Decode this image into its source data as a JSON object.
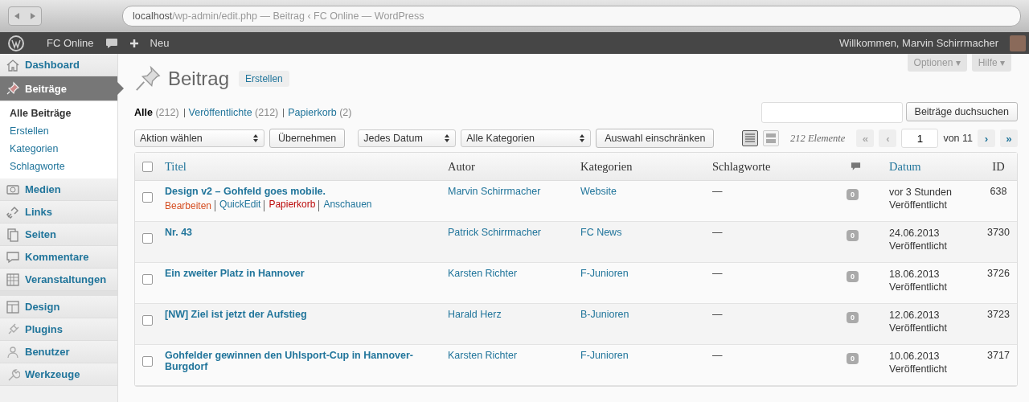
{
  "browser": {
    "address_host": "localhost",
    "address_path": "/wp-admin/edit.php — Beitrag ‹ FC Online — WordPress"
  },
  "admin_bar": {
    "site": "FC Online",
    "new": "Neu",
    "greeting": "Willkommen, Marvin Schirrmacher"
  },
  "screen_meta": [
    "Optionen ▾",
    "Hilfe ▾"
  ],
  "sidebar": {
    "items": [
      {
        "label": "Dashboard",
        "kind": "dashboard",
        "selected": false
      },
      {
        "label": "Beiträge",
        "kind": "posts",
        "selected": true,
        "children": [
          {
            "label": "Alle Beiträge",
            "selected": true
          },
          {
            "label": "Erstellen",
            "selected": false
          },
          {
            "label": "Kategorien",
            "selected": false
          },
          {
            "label": "Schlagworte",
            "selected": false
          }
        ]
      },
      {
        "label": "Medien",
        "kind": "media",
        "selected": false
      },
      {
        "label": "Links",
        "kind": "links",
        "selected": false
      },
      {
        "label": "Seiten",
        "kind": "pages",
        "selected": false
      },
      {
        "label": "Kommentare",
        "kind": "comments",
        "selected": false
      },
      {
        "label": "Veranstaltungen",
        "kind": "events",
        "selected": false
      },
      {
        "label": "Design",
        "kind": "design",
        "selected": false
      },
      {
        "label": "Plugins",
        "kind": "plugins",
        "selected": false
      },
      {
        "label": "Benutzer",
        "kind": "users",
        "selected": false
      },
      {
        "label": "Werkzeuge",
        "kind": "tools",
        "selected": false
      }
    ]
  },
  "page": {
    "title": "Beitrag",
    "add_button": "Erstellen"
  },
  "views": [
    {
      "label": "Alle",
      "count": "(212)",
      "selected": true
    },
    {
      "label": "Veröffentlichte",
      "count": "(212)",
      "selected": false
    },
    {
      "label": "Papierkorb",
      "count": "(2)",
      "selected": false
    }
  ],
  "search": {
    "button": "Beiträge duchsuchen"
  },
  "tablenav": {
    "bulk_action": "Aktion wählen",
    "apply": "Übernehmen",
    "date_filter": "Jedes Datum",
    "category_filter": "Alle Kategorien",
    "filter_button": "Auswahl einschränken",
    "view_modes": [
      {
        "kind": "list",
        "selected": true
      },
      {
        "kind": "excerpt",
        "selected": false
      }
    ],
    "count": "212 Elemente",
    "first": "«",
    "prev": "‹",
    "page": "1",
    "of": "von 11",
    "next": "›",
    "last": "»"
  },
  "table": {
    "select_all_checked": false,
    "columns": [
      {
        "label": "Titel",
        "sortable": true
      },
      {
        "label": "Autor",
        "sortable": false
      },
      {
        "label": "Kategorien",
        "sortable": false
      },
      {
        "label": "Schlagworte",
        "sortable": false
      },
      {
        "kind": "comments",
        "sortable": false
      },
      {
        "label": "Datum",
        "sortable": true
      },
      {
        "label": "ID",
        "sortable": false
      }
    ],
    "rows": [
      {
        "checked": false,
        "title": "Design v2 – Gohfeld goes mobile.",
        "actions": [
          {
            "label": "Bearbeiten",
            "kind": "edit"
          },
          {
            "label": "QuickEdit",
            "kind": "link"
          },
          {
            "label": "Papierkorb",
            "kind": "trash"
          },
          {
            "label": "Anschauen",
            "kind": "link"
          }
        ],
        "author": "Marvin Schirrmacher",
        "category": "Website",
        "tags": "—",
        "comments": "0",
        "date": "vor 3 Stunden",
        "status": "Veröffentlicht",
        "id": "638"
      },
      {
        "checked": false,
        "title": "Nr. 43",
        "author": "Patrick Schirrmacher",
        "category": "FC News",
        "tags": "—",
        "comments": "0",
        "date": "24.06.2013",
        "status": "Veröffentlicht",
        "id": "3730"
      },
      {
        "checked": false,
        "title": "Ein zweiter Platz in Hannover",
        "author": "Karsten Richter",
        "category": "F-Junioren",
        "tags": "—",
        "comments": "0",
        "date": "18.06.2013",
        "status": "Veröffentlicht",
        "id": "3726"
      },
      {
        "checked": false,
        "title": "[NW] Ziel ist jetzt der Aufstieg",
        "author": "Harald Herz",
        "category": "B-Junioren",
        "tags": "—",
        "comments": "0",
        "date": "12.06.2013",
        "status": "Veröffentlicht",
        "id": "3723"
      },
      {
        "checked": false,
        "title": "Gohfelder gewinnen den Uhlsport-Cup in Hannover-Burgdorf",
        "author": "Karsten Richter",
        "category": "F-Junioren",
        "tags": "—",
        "comments": "0",
        "date": "10.06.2013",
        "status": "Veröffentlicht",
        "id": "3717"
      }
    ]
  }
}
